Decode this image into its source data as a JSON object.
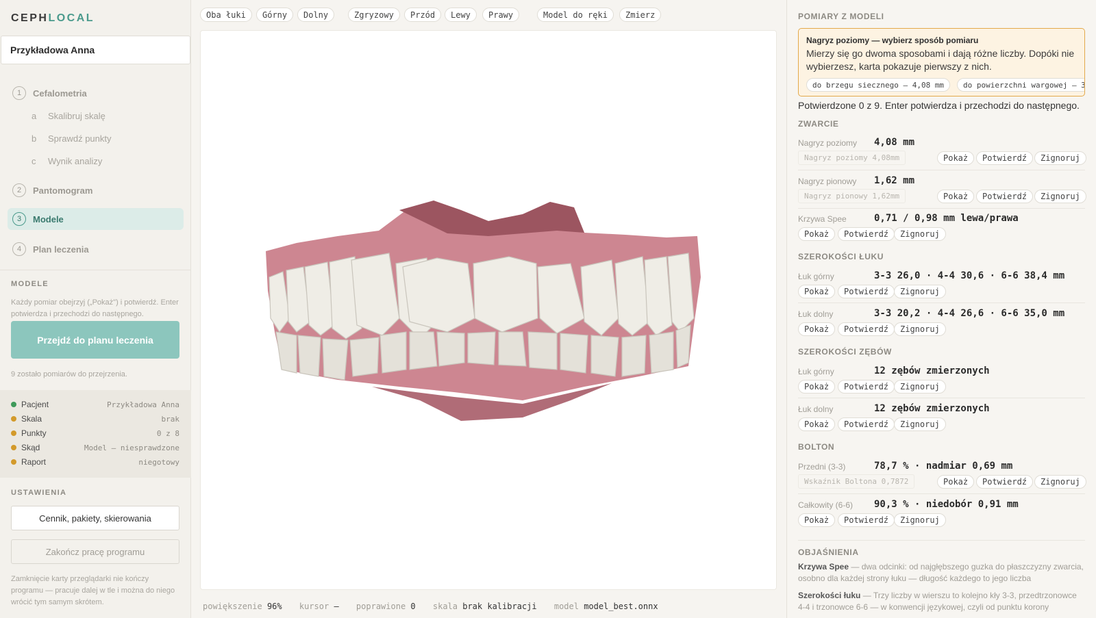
{
  "app": {
    "logo_prefix": "CEPH",
    "logo_accent": "LOCAL",
    "patient_name": "Przykładowa Anna"
  },
  "steps": [
    {
      "num": "1",
      "label": "Cefalometria"
    },
    {
      "num": "2",
      "label": "Pantomogram"
    },
    {
      "num": "3",
      "label": "Modele"
    },
    {
      "num": "4",
      "label": "Plan leczenia"
    }
  ],
  "substeps": [
    {
      "letter": "a",
      "label": "Skalibruj skalę"
    },
    {
      "letter": "b",
      "label": "Sprawdź punkty"
    },
    {
      "letter": "c",
      "label": "Wynik analizy"
    }
  ],
  "models_panel": {
    "title": "MODELE",
    "hint": "Każdy pomiar obejrzyj („Pokaż\") i potwierdź. Enter potwierdza i przechodzi do następnego.",
    "go_button": "Przejdź do planu leczenia",
    "remaining": "9 zostało pomiarów do przejrzenia."
  },
  "status": [
    {
      "label": "Pacjent",
      "value": "Przykładowa Anna",
      "color": "#3f9a5a"
    },
    {
      "label": "Skala",
      "value": "brak",
      "color": "#d39a2b"
    },
    {
      "label": "Punkty",
      "value": "0 z 8",
      "color": "#d39a2b"
    },
    {
      "label": "Skąd",
      "value": "Model — niesprawdzone",
      "color": "#d39a2b"
    },
    {
      "label": "Raport",
      "value": "niegotowy",
      "color": "#d39a2b"
    }
  ],
  "settings": {
    "title": "USTAWIENIA",
    "pricing_button": "Cennik, pakiety, skierowania",
    "quit_button": "Zakończ pracę programu",
    "note": "Zamknięcie karty przeglądarki nie kończy programu — pracuje dalej w tle i można do niego wrócić tym samym skrótem."
  },
  "toolbar": {
    "views": [
      "Oba łuki",
      "Górny",
      "Dolny"
    ],
    "angles": [
      "Zgryzowy",
      "Przód",
      "Lewy",
      "Prawy"
    ],
    "tools": [
      "Model do ręki",
      "Zmierz"
    ]
  },
  "statusbar": {
    "zoom_label": "powiększenie",
    "zoom_value": "96%",
    "cursor_label": "kursor",
    "cursor_value": "—",
    "fixed_label": "poprawione",
    "fixed_value": "0",
    "scale_label": "skala",
    "scale_value": "brak kalibracji",
    "model_label": "model",
    "model_value": "model_best.onnx"
  },
  "right": {
    "title": "POMIARY Z MODELI",
    "warn_title": "Nagryz poziomy — wybierz sposób pomiaru",
    "warn_text": "Mierzy się go dwoma sposobami i dają różne liczby. Dopóki nie wybierzesz, karta pokazuje pierwszy z nich.",
    "warn_options": [
      "do brzegu siecznego — 4,08 mm",
      "do powierzchni wargowej — 3,"
    ],
    "confirmed": "Potwierdzone 0 z 9. Enter potwierdza i przechodzi do następnego.",
    "chip_show": "Pokaż",
    "chip_confirm": "Potwierdź",
    "chip_ignore": "Zignoruj",
    "sections": {
      "occlusion": "ZWARCIE",
      "arch_width": "SZEROKOŚCI ŁUKU",
      "tooth_width": "SZEROKOŚCI ZĘBÓW",
      "bolton": "BOLTON",
      "explanations": "OBJAŚNIENIA"
    },
    "measurements": {
      "overjet": {
        "label": "Nagryz poziomy",
        "value": "4,08 mm",
        "hint": "Nagryz poziomy 4,08mm"
      },
      "overbite": {
        "label": "Nagryz pionowy",
        "value": "1,62 mm",
        "hint": "Nagryz pionowy 1,62mm"
      },
      "spee": {
        "label": "Krzywa Spee",
        "value": "0,71 / 0,98 mm lewa/prawa"
      },
      "upper_arch": {
        "label": "Łuk górny",
        "value": "3-3 26,0 · 4-4 30,6 · 6-6 38,4 mm"
      },
      "lower_arch": {
        "label": "Łuk dolny",
        "value": "3-3 20,2 · 4-4 26,6 · 6-6 35,0 mm"
      },
      "upper_teeth": {
        "label": "Łuk górny",
        "value": "12 zębów zmierzonych"
      },
      "lower_teeth": {
        "label": "Łuk dolny",
        "value": "12 zębów zmierzonych"
      },
      "bolton_front": {
        "label": "Przedni (3-3)",
        "value": "78,7 % · nadmiar 0,69 mm",
        "hint": "Wskaźnik Boltona 0,7872"
      },
      "bolton_total": {
        "label": "Całkowity (6-6)",
        "value": "90,3 % · niedobór 0,91 mm"
      }
    },
    "explanations": [
      {
        "term": "Krzywa Spee",
        "text": " — dwa odcinki: od najgłębszego guzka do płaszczyzny zwarcia, osobno dla każdej strony łuku — długość każdego to jego liczba"
      },
      {
        "term": "Szerokości łuku",
        "text": " — Trzy liczby w wierszu to kolejno kły 3-3, przedtrzonowce 4-4 i trzonowce 6-6 — w konwencji językowej, czyli od punktu korony"
      }
    ]
  },
  "colors": {
    "accent": "#4a9a8c",
    "warning": "#e3a94a",
    "ok": "#3f9a5a"
  }
}
